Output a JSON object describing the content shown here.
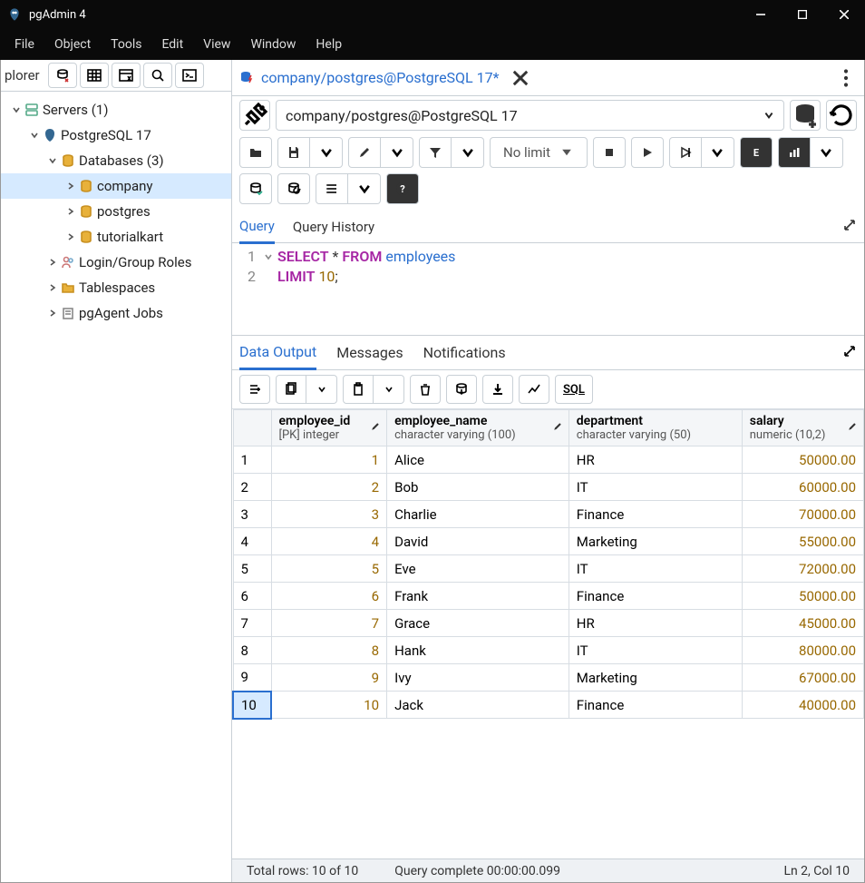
{
  "app": {
    "title": "pgAdmin 4"
  },
  "menu": [
    "File",
    "Object",
    "Tools",
    "Edit",
    "View",
    "Window",
    "Help"
  ],
  "explorer": {
    "label": "plorer",
    "tree": {
      "servers": {
        "label": "Servers (1)"
      },
      "pg": {
        "label": "PostgreSQL 17"
      },
      "databases": {
        "label": "Databases (3)"
      },
      "db1": {
        "label": "company"
      },
      "db2": {
        "label": "postgres"
      },
      "db3": {
        "label": "tutorialkart"
      },
      "roles": {
        "label": "Login/Group Roles"
      },
      "tablespaces": {
        "label": "Tablespaces"
      },
      "pgagent": {
        "label": "pgAgent Jobs"
      }
    }
  },
  "tab": {
    "title": "company/postgres@PostgreSQL 17*"
  },
  "connection": {
    "text": "company/postgres@PostgreSQL 17"
  },
  "toolbar": {
    "limit": "No limit"
  },
  "qtabs": {
    "query": "Query",
    "history": "Query History"
  },
  "sql": {
    "line1": {
      "kw1": "SELECT",
      "star": " * ",
      "kw2": "FROM",
      "sp": " ",
      "ident": "employees"
    },
    "line2": {
      "kw": "LIMIT",
      "sp": " ",
      "num": "10",
      "semi": ";"
    },
    "gutter": [
      "1",
      "2"
    ]
  },
  "otabs": {
    "data": "Data Output",
    "messages": "Messages",
    "notifications": "Notifications"
  },
  "otoolbar": {
    "sql": "SQL"
  },
  "columns": [
    {
      "name": "employee_id",
      "type": "[PK] integer"
    },
    {
      "name": "employee_name",
      "type": "character varying (100)"
    },
    {
      "name": "department",
      "type": "character varying (50)"
    },
    {
      "name": "salary",
      "type": "numeric (10,2)"
    }
  ],
  "rows": [
    {
      "n": "1",
      "id": "1",
      "name": "Alice",
      "dept": "HR",
      "salary": "50000.00"
    },
    {
      "n": "2",
      "id": "2",
      "name": "Bob",
      "dept": "IT",
      "salary": "60000.00"
    },
    {
      "n": "3",
      "id": "3",
      "name": "Charlie",
      "dept": "Finance",
      "salary": "70000.00"
    },
    {
      "n": "4",
      "id": "4",
      "name": "David",
      "dept": "Marketing",
      "salary": "55000.00"
    },
    {
      "n": "5",
      "id": "5",
      "name": "Eve",
      "dept": "IT",
      "salary": "72000.00"
    },
    {
      "n": "6",
      "id": "6",
      "name": "Frank",
      "dept": "Finance",
      "salary": "50000.00"
    },
    {
      "n": "7",
      "id": "7",
      "name": "Grace",
      "dept": "HR",
      "salary": "45000.00"
    },
    {
      "n": "8",
      "id": "8",
      "name": "Hank",
      "dept": "IT",
      "salary": "80000.00"
    },
    {
      "n": "9",
      "id": "9",
      "name": "Ivy",
      "dept": "Marketing",
      "salary": "67000.00"
    },
    {
      "n": "10",
      "id": "10",
      "name": "Jack",
      "dept": "Finance",
      "salary": "40000.00"
    }
  ],
  "status": {
    "rows": "Total rows: 10 of 10",
    "time": "Query complete 00:00:00.099",
    "pos": "Ln 2, Col 10"
  }
}
